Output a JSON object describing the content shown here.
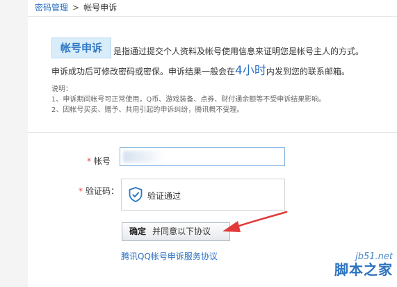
{
  "breadcrumb": {
    "parent": "密码管理",
    "separator": ">",
    "current": "帐号申诉"
  },
  "intro": {
    "title": "帐号申诉",
    "line1": "是指通过提交个人资料及帐号使用信息来证明您是帐号主人的方式。",
    "line2_before": "申诉成功后可修改密码或密保。申诉结果一般会在",
    "line2_time": "4小时",
    "line2_after": "内发到您的联系邮箱。"
  },
  "notes": {
    "heading": "说明：",
    "item1": "1、申诉期间帐号可正常使用，Q币、游戏装备、点券、财付通余额等不受申诉结果影响。",
    "item2": "2、因帐号买卖、赠予、共用引起的申诉纠纷，腾讯概不受理。"
  },
  "form": {
    "required_mark": "*",
    "account_label": "帐号",
    "captcha_label": "验证码：",
    "captcha_status": "验证通过",
    "confirm_label": "确定",
    "confirm_suffix": "并同意以下协议",
    "agreement_link": "腾讯QQ帐号申诉服务协议"
  },
  "watermark": {
    "site": "jb51.net",
    "name": "脚本之家"
  },
  "colors": {
    "link": "#2b6fc2",
    "required": "#e44444",
    "arrow": "#e23a3a",
    "tag_bg": "#d8ecfa"
  }
}
